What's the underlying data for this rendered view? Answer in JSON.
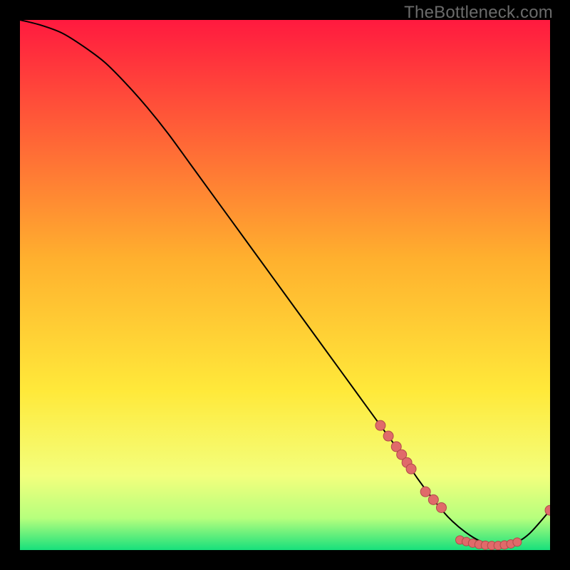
{
  "watermark": "TheBottleneck.com",
  "colors": {
    "bg_outer": "#000000",
    "gradient_top": "#ff1a3f",
    "gradient_mid": "#ffd22e",
    "gradient_low": "#f3ff7d",
    "gradient_bottom": "#17e07c",
    "curve": "#000000",
    "marker_fill": "#e06a6a",
    "marker_stroke": "#b24a4a"
  },
  "chart_data": {
    "type": "line",
    "title": "",
    "xlabel": "",
    "ylabel": "",
    "xlim": [
      0,
      100
    ],
    "ylim": [
      0,
      100
    ],
    "series": [
      {
        "name": "bottleneck-curve",
        "x": [
          0,
          4,
          8,
          12,
          16,
          20,
          24,
          28,
          32,
          36,
          40,
          44,
          48,
          52,
          56,
          60,
          64,
          68,
          72,
          75,
          78,
          81,
          84,
          87,
          90,
          93,
          96,
          100
        ],
        "y": [
          100,
          99,
          97.5,
          95,
          92,
          88,
          83.5,
          78.5,
          73,
          67.5,
          62,
          56.5,
          51,
          45.5,
          40,
          34.5,
          29,
          23.5,
          18,
          13.5,
          9.5,
          6,
          3.4,
          1.6,
          0.8,
          1.2,
          3,
          7.5
        ]
      }
    ],
    "markers_cluster_a": {
      "name": "markers-upper-segment",
      "x": [
        68,
        69.5,
        71,
        72,
        73,
        73.8
      ],
      "y": [
        23.5,
        21.5,
        19.5,
        18,
        16.5,
        15.3
      ]
    },
    "markers_cluster_b": {
      "name": "markers-lower-segment",
      "x": [
        76.5,
        78,
        79.5
      ],
      "y": [
        11,
        9.5,
        8
      ]
    },
    "markers_trough": {
      "name": "markers-trough",
      "x": [
        83,
        84.2,
        85.4,
        86.6,
        87.8,
        89,
        90.2,
        91.4,
        92.6,
        93.8
      ],
      "y": [
        1.9,
        1.6,
        1.3,
        1.05,
        0.9,
        0.85,
        0.85,
        0.95,
        1.15,
        1.5
      ]
    },
    "markers_end": {
      "name": "marker-end",
      "x": [
        100
      ],
      "y": [
        7.5
      ]
    }
  }
}
